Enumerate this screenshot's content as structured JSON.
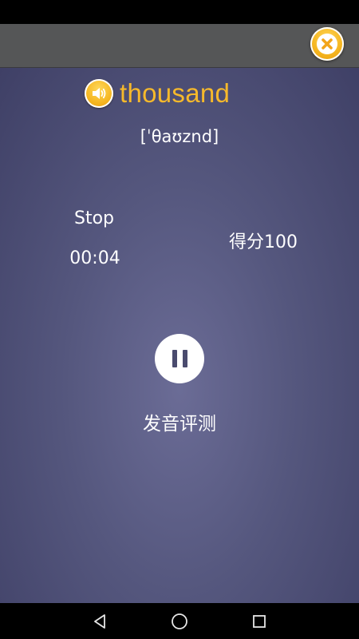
{
  "header": {
    "close_icon": "close-icon"
  },
  "word": {
    "text": "thousand",
    "phonetic": "[ˈθaʊznd]",
    "speaker_icon": "speaker-icon",
    "color": "#f6b92b"
  },
  "recording": {
    "status": "Stop",
    "timer": "00:04",
    "score": "得分100"
  },
  "controls": {
    "pause_icon": "pause-icon",
    "label": "发音评测"
  },
  "navigation": {
    "back_icon": "back-icon",
    "home_icon": "home-icon",
    "recents_icon": "recents-icon"
  }
}
